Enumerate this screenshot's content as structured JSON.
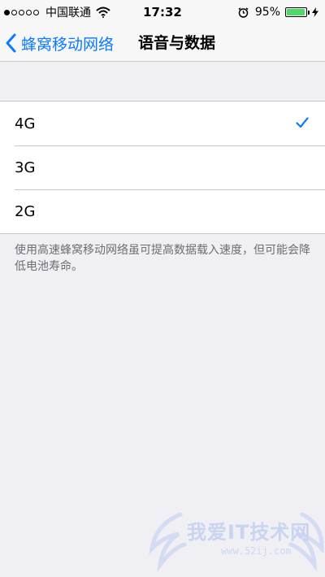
{
  "status_bar": {
    "carrier": "中国联通",
    "time": "17:32",
    "battery_percent": "95%",
    "battery_level": 0.95,
    "signal_bars_filled": 1,
    "signal_bars_total": 5,
    "battery_color": "#4cd964"
  },
  "nav": {
    "back_label": "蜂窝移动网络",
    "title": "语音与数据",
    "accent_color": "#0a7aff"
  },
  "options": [
    {
      "label": "4G",
      "selected": true
    },
    {
      "label": "3G",
      "selected": false
    },
    {
      "label": "2G",
      "selected": false
    }
  ],
  "footer_note": "使用高速蜂窝移动网络虽可提高数据载入速度，但可能会降低电池寿命。",
  "watermark": {
    "text": "我爱IT技术网",
    "url": "www.52ij.com"
  }
}
